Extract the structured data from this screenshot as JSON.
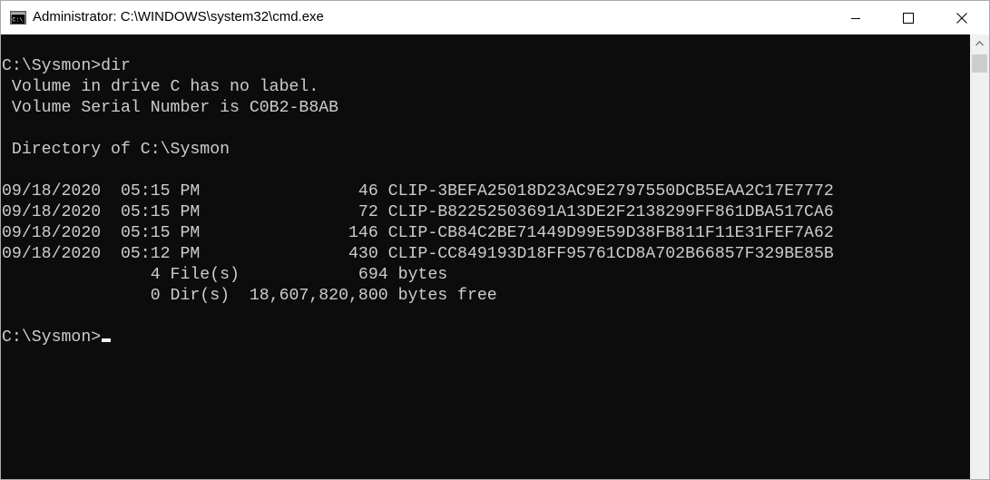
{
  "window": {
    "title": "Administrator: C:\\WINDOWS\\system32\\cmd.exe"
  },
  "controls": {
    "minimize": "minimize",
    "maximize": "maximize",
    "close": "close"
  },
  "console": {
    "lines": [
      "C:\\Sysmon>dir",
      " Volume in drive C has no label.",
      " Volume Serial Number is C0B2-B8AB",
      "",
      " Directory of C:\\Sysmon",
      "",
      "09/18/2020  05:15 PM                46 CLIP-3BEFA25018D23AC9E2797550DCB5EAA2C17E7772",
      "09/18/2020  05:15 PM                72 CLIP-B82252503691A13DE2F2138299FF861DBA517CA6",
      "09/18/2020  05:15 PM               146 CLIP-CB84C2BE71449D99E59D38FB811F11E31FEF7A62",
      "09/18/2020  05:12 PM               430 CLIP-CC849193D18FF95761CD8A702B66857F329BE85B",
      "               4 File(s)            694 bytes",
      "               0 Dir(s)  18,607,820,800 bytes free",
      ""
    ],
    "prompt": "C:\\Sysmon>"
  },
  "colors": {
    "background": "#0c0c0c",
    "foreground": "#cccccc",
    "titlebar": "#ffffff"
  }
}
